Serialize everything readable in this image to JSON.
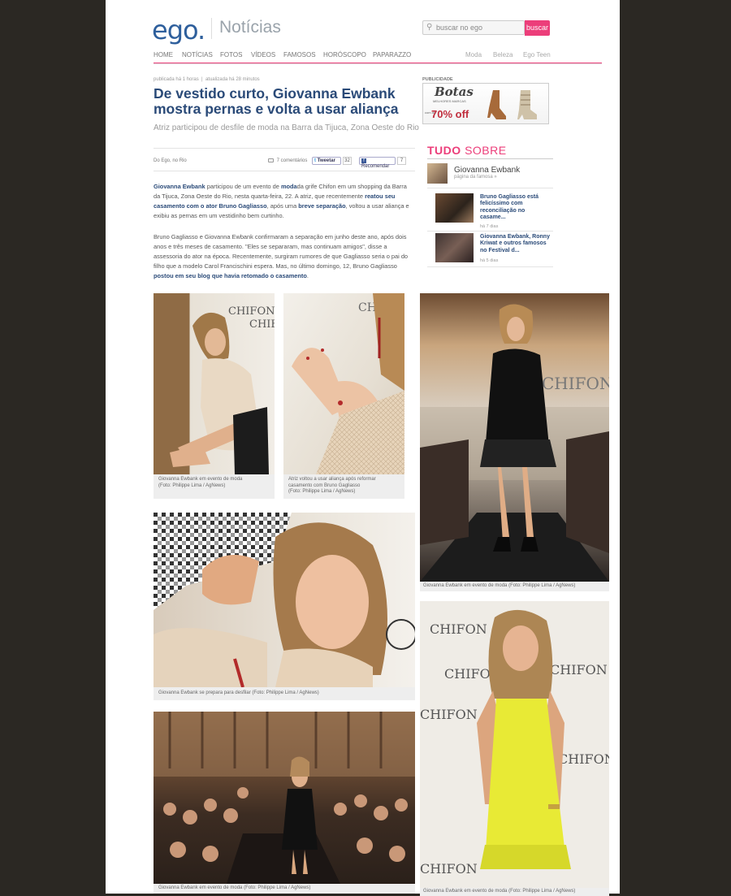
{
  "header": {
    "logo": "ego.",
    "section": "Notícias",
    "search_placeholder": "buscar no ego",
    "search_button": "buscar"
  },
  "nav": {
    "left": [
      "HOME",
      "NOTÍCIAS",
      "FOTOS",
      "VÍDEOS",
      "FAMOSOS",
      "HORÓSCOPO",
      "PAPARAZZO"
    ],
    "right": [
      "Moda",
      "Beleza",
      "Ego Teen"
    ]
  },
  "article": {
    "published": "publicada há 1 horas",
    "updated": "atualizada há 28 minutos",
    "headline": "De vestido curto, Giovanna Ewbank mostra pernas e volta a usar aliança",
    "subtitle": "Atriz participou de desfile de moda na Barra da Tijuca, Zona Oeste do Rio",
    "byline": "Do Ego, no Rio",
    "comments": "7 comentários",
    "tweet_label": "Tweetar",
    "tweet_count": "32",
    "like_label": "Recomendar",
    "like_count": "7",
    "p1": {
      "s1": "Giovanna Ewbank",
      "s2": " participou de um evento de ",
      "s3": "moda",
      "s4": "da grife Chifon em um shopping da Barra da Tijuca, Zona Oeste do Rio, nesta quarta-feira, 22. A atriz, que recentemente ",
      "s5": "reatou seu casamento com o ator Bruno Gagliasso",
      "s6": ", após uma ",
      "s7": "breve separação",
      "s8": ", voltou a usar aliança e exibiu as pernas em um vestidinho bem curtinho."
    },
    "p2": {
      "s1": "Bruno Gagliasso e Giovanna Ewbank confirmaram a separação em junho deste ano, após dois anos e três meses de casamento. \"Eles se separaram, mas continuam amigos\", disse a assessoria do ator na época. Recentemente, surgiram rumores de que Gagliasso seria o pai do filho que a modelo Carol Francischini espera. Mas, no último domingo, 12, Bruno Gagliasso ",
      "s2": "postou em seu blog que havia retomado o casamento",
      "s3": "."
    }
  },
  "sidebar": {
    "pub_label": "PUBLICIDADE",
    "ad": {
      "title": "Botas",
      "sub": "MELHORES MARCAS",
      "sale_prefix": "com até",
      "sale": "70% off"
    },
    "tudo": "TUDO",
    "sobre": "SOBRE",
    "famosa_name": "Giovanna Ewbank",
    "famosa_link": "página da famosa »",
    "news": [
      {
        "title": "Bruno Gagliasso está felicíssimo com reconciliação no casame...",
        "time": "há 7 dias"
      },
      {
        "title": "Giovanna Ewbank, Ronny Kriwat e outros famosos no Festival d...",
        "time": "há 5 dias"
      }
    ]
  },
  "photos": [
    {
      "caption": "Giovanna Ewbank em evento de moda\n(Foto: Philippe Lima / AgNews)"
    },
    {
      "caption": "Atriz voltou a usar aliança após reformar casamento com Bruno Gagliasso\n(Foto: Philippe Lima / AgNews)"
    },
    {
      "caption": "Giovanna Ewbank em evento de moda (Foto: Philippe Lima / AgNews)"
    },
    {
      "caption": "Giovanna Ewbank se prepara para desfilar  (Foto: Philippe Lima / AgNews)"
    },
    {
      "caption": "Giovanna Ewbank em evento de moda (Foto: Philippe Lima / AgNews)"
    },
    {
      "caption": "Giovanna Ewbank em evento de moda (Foto: Philippe Lima / AgNews)"
    }
  ],
  "photo_signage": {
    "brand": "CHIFON"
  },
  "colors": {
    "accent": "#ec3e7a",
    "link": "#2a4a78",
    "logo": "#2e5f9c",
    "background": "#2b2823"
  }
}
